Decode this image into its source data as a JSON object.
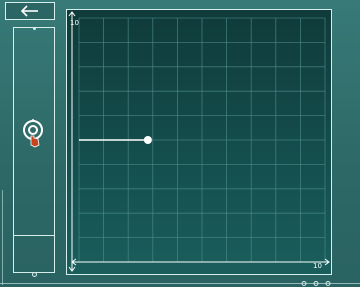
{
  "navigation": {
    "back_icon": "arrow-left-icon"
  },
  "tools": {
    "active_tool_icon": "ring-target-icon"
  },
  "graph": {
    "y_axis_max_label": "10",
    "x_axis_max_label": "10",
    "grid_divisions": 10,
    "x_max": 10,
    "y_max": 10,
    "segment": {
      "x_start": 0,
      "x_end": 2.8,
      "y": 5.0
    }
  },
  "colors": {
    "background": "#2f6b69",
    "grid_background": "#103c3b",
    "grid_line": "#4f8e8b",
    "foreground": "#ffffff",
    "cursor_accent": "#c7441f"
  }
}
